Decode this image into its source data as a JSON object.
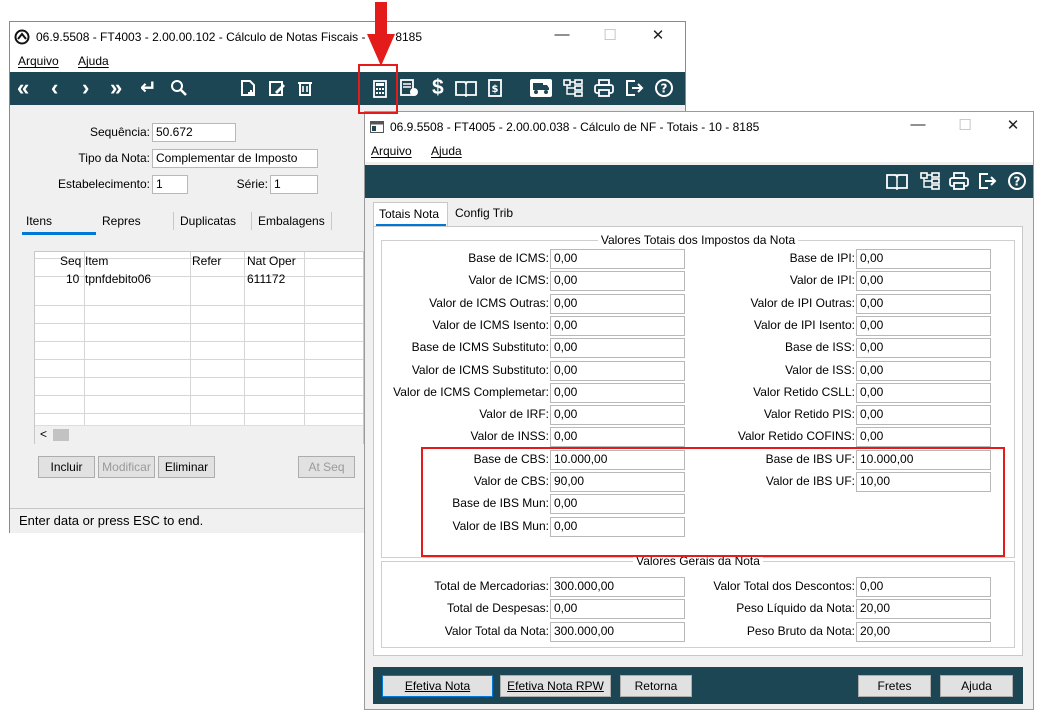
{
  "back_window": {
    "title": "06.9.5508 - FT4003 - 2.00.00.102 - Cálculo de Notas Fiscais -",
    "title_suffix": "- 8185",
    "menu": [
      "Arquivo",
      "Ajuda"
    ],
    "fields": {
      "sequencia_label": "Sequência:",
      "sequencia_value": "50.672",
      "tipo_label": "Tipo da Nota:",
      "tipo_value": "Complementar de Imposto",
      "estab_label": "Estabelecimento:",
      "estab_value": "1",
      "serie_label": "Série:",
      "serie_value": "1"
    },
    "tabs": [
      "Itens",
      "Repres",
      "Duplicatas",
      "Embalagens"
    ],
    "grid": {
      "headers": [
        "Seq",
        "Item",
        "Refer",
        "Nat Oper"
      ],
      "rows": [
        {
          "seq": "10",
          "item": "tpnfdebito06",
          "refer": "",
          "nat": "611172"
        }
      ]
    },
    "buttons": {
      "incluir": "Incluir",
      "modificar": "Modificar",
      "eliminar": "Eliminar",
      "atseq": "At Seq"
    },
    "scroll_left": "<",
    "status": "Enter data or press ESC to end."
  },
  "front_window": {
    "title": "06.9.5508 - FT4005 - 2.00.00.038 - Cálculo de NF - Totais - 10 - 8185",
    "menu": [
      "Arquivo",
      "Ajuda"
    ],
    "tabs": [
      "Totais Nota",
      "Config Trib"
    ],
    "group1_title": "Valores Totais dos Impostos da Nota",
    "left_fields": [
      {
        "label": "Base de ICMS:",
        "value": "0,00"
      },
      {
        "label": "Valor de ICMS:",
        "value": "0,00"
      },
      {
        "label": "Valor de ICMS Outras:",
        "value": "0,00"
      },
      {
        "label": "Valor de ICMS Isento:",
        "value": "0,00"
      },
      {
        "label": "Base de ICMS Substituto:",
        "value": "0,00"
      },
      {
        "label": "Valor de ICMS Substituto:",
        "value": "0,00"
      },
      {
        "label": "Valor de ICMS Complemetar:",
        "value": "0,00"
      },
      {
        "label": "Valor de IRF:",
        "value": "0,00"
      },
      {
        "label": "Valor de INSS:",
        "value": "0,00"
      },
      {
        "label": "Base de CBS:",
        "value": "10.000,00"
      },
      {
        "label": "Valor de CBS:",
        "value": "90,00"
      },
      {
        "label": "Base de IBS Mun:",
        "value": "0,00"
      },
      {
        "label": "Valor de IBS Mun:",
        "value": "0,00"
      }
    ],
    "right_fields": [
      {
        "label": "Base de IPI:",
        "value": "0,00"
      },
      {
        "label": "Valor de IPI:",
        "value": "0,00"
      },
      {
        "label": "Valor de IPI Outras:",
        "value": "0,00"
      },
      {
        "label": "Valor de IPI Isento:",
        "value": "0,00"
      },
      {
        "label": "Base de ISS:",
        "value": "0,00"
      },
      {
        "label": "Valor de ISS:",
        "value": "0,00"
      },
      {
        "label": "Valor Retido CSLL:",
        "value": "0,00"
      },
      {
        "label": "Valor Retido PIS:",
        "value": "0,00"
      },
      {
        "label": "Valor Retido COFINS:",
        "value": "0,00"
      },
      {
        "label": "Base de IBS UF:",
        "value": "10.000,00"
      },
      {
        "label": "Valor de IBS UF:",
        "value": "10,00"
      }
    ],
    "group2_title": "Valores Gerais da Nota",
    "gerais_left": [
      {
        "label": "Total de Mercadorias:",
        "value": "300.000,00"
      },
      {
        "label": "Total de Despesas:",
        "value": "0,00"
      },
      {
        "label": "Valor Total da Nota:",
        "value": "300.000,00"
      }
    ],
    "gerais_right": [
      {
        "label": "Valor Total dos Descontos:",
        "value": "0,00"
      },
      {
        "label": "Peso Líquido da Nota:",
        "value": "20,00"
      },
      {
        "label": "Peso Bruto da Nota:",
        "value": "20,00"
      }
    ],
    "buttons": {
      "efetiva": "Efetiva Nota",
      "efetiva_rpw": "Efetiva Nota RPW",
      "retorna": "Retorna",
      "fretes": "Fretes",
      "ajuda": "Ajuda"
    }
  },
  "colors": {
    "toolbar": "#1d4655",
    "highlight": "#e31b1b",
    "accent": "#0078d7"
  }
}
